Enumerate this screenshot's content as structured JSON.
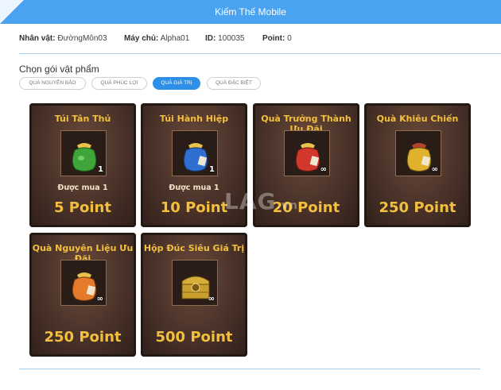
{
  "app": {
    "title": "Kiếm Thế Mobile"
  },
  "player_info": [
    {
      "label": "Nhân vật:",
      "value": "ĐườngMôn03"
    },
    {
      "label": "Máy chủ:",
      "value": "Alpha01"
    },
    {
      "label": "ID:",
      "value": "100035"
    },
    {
      "label": "Point:",
      "value": "0"
    }
  ],
  "section_title": "Chọn gói vật phẩm",
  "tabs": [
    {
      "label": "QUÀ NGUYÊN BẢO",
      "active": false
    },
    {
      "label": "QUÀ PHÚC LỢI",
      "active": false
    },
    {
      "label": "QUÀ GIÁ TRỊ",
      "active": true
    },
    {
      "label": "QUÀ ĐẶC BIỆT",
      "active": false
    }
  ],
  "packages": [
    {
      "name": "Túi Tân Thủ",
      "icon": "green-bag-icon",
      "bag_color": "#3fa43a",
      "quantity": "1",
      "limit": "Được mua 1",
      "price": "5 Point"
    },
    {
      "name": "Túi Hành Hiệp",
      "icon": "blue-bag-icon",
      "bag_color": "#2f6fd0",
      "quantity": "1",
      "limit": "Được mua 1",
      "price": "10 Point"
    },
    {
      "name": "Quà Trưởng Thành Ưu Đãi",
      "icon": "red-bag-icon",
      "bag_color": "#d2372c",
      "quantity": "∞",
      "limit": "",
      "price": "20 Point"
    },
    {
      "name": "Quà Khiêu Chiến",
      "icon": "gold-bag-icon",
      "bag_color": "#e0b12c",
      "quantity": "∞",
      "limit": "",
      "price": "250 Point"
    },
    {
      "name": "Quà Nguyên Liệu Ưu Đãi",
      "icon": "orange-bag-icon",
      "bag_color": "#e57a2a",
      "quantity": "∞",
      "limit": "",
      "price": "250 Point"
    },
    {
      "name": "Hộp Đúc Siêu Giá Trị",
      "icon": "gold-chest-icon",
      "bag_color": "#c9a02e",
      "quantity": "∞",
      "limit": "",
      "price": "500 Point"
    }
  ],
  "watermark": {
    "text": "LAG",
    "suffix": ".vn"
  }
}
